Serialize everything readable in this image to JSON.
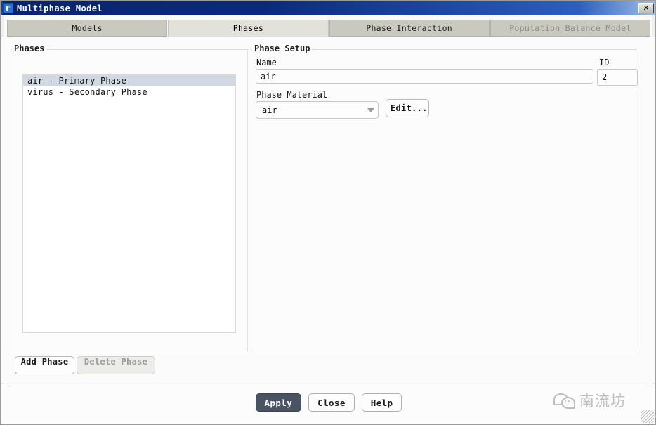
{
  "window": {
    "title": "Multiphase Model",
    "app_icon": "F",
    "close_icon": "✕"
  },
  "tabs": [
    {
      "label": "Models",
      "state": "normal"
    },
    {
      "label": "Phases",
      "state": "selected"
    },
    {
      "label": "Phase Interaction",
      "state": "normal"
    },
    {
      "label": "Population Balance Model",
      "state": "disabled"
    }
  ],
  "phases_panel": {
    "group_label": "Phases",
    "items": [
      {
        "label": "air - Primary Phase",
        "selected": true
      },
      {
        "label": "virus - Secondary Phase",
        "selected": false
      }
    ],
    "add_phase_label": "Add Phase",
    "delete_phase_label": "Delete Phase"
  },
  "phase_setup": {
    "group_label": "Phase Setup",
    "name_label": "Name",
    "name_value": "air",
    "id_label": "ID",
    "id_value": "2",
    "material_label": "Phase Material",
    "material_value": "air",
    "material_arrow_icon": "chevron-down-icon",
    "edit_label": "Edit..."
  },
  "footer": {
    "apply_label": "Apply",
    "close_label": "Close",
    "help_label": "Help"
  },
  "watermark": {
    "text": "南流坊",
    "logo": "wechat-bubble-icon"
  },
  "colors": {
    "titlebar_start": "#0a246a",
    "titlebar_end": "#9fc0e8",
    "tab_selected_bg": "#e2e2da",
    "tab_bg": "#c9c9c0",
    "list_selection": "#d2d9e4",
    "primary_button_bg": "#4a5364",
    "disabled_text": "#9a9a95"
  }
}
